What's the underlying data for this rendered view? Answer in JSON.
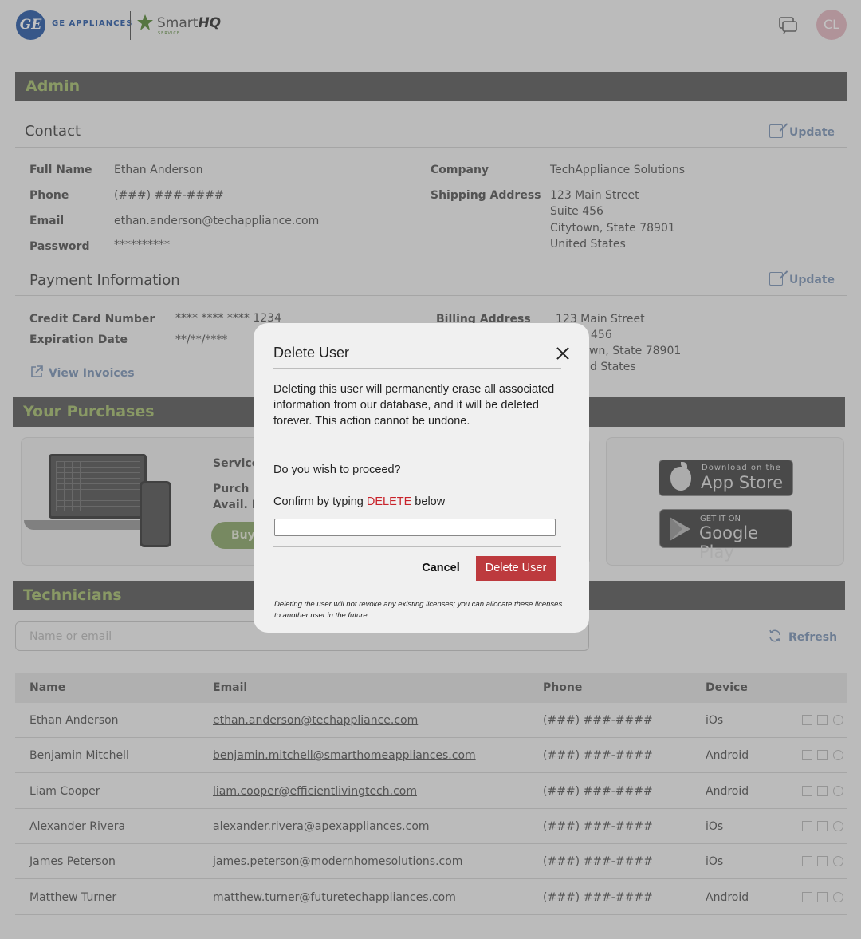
{
  "header": {
    "brand_text": "GE APPLIANCES",
    "brand_logo_text": "GE",
    "smarthq_prefix": "Smart",
    "smarthq_bold": "HQ",
    "smarthq_sub": "SERVICE",
    "avatar_initials": "CL"
  },
  "admin": {
    "bar_title": "Admin",
    "contact_title": "Contact",
    "update_label": "Update",
    "labels": {
      "full_name": "Full Name",
      "phone": "Phone",
      "email": "Email",
      "password": "Password",
      "company": "Company",
      "shipping": "Shipping Address"
    },
    "values": {
      "full_name": "Ethan Anderson",
      "phone": "(###) ###-####",
      "email": "ethan.anderson@techappliance.com",
      "password": "**********",
      "company": "TechAppliance Solutions",
      "shipping_1": "123 Main Street",
      "shipping_2": "Suite 456",
      "shipping_3": "Citytown, State 78901",
      "shipping_4": "United States"
    }
  },
  "payment": {
    "title": "Payment Information",
    "update_label": "Update",
    "cc_label": "Credit Card Number",
    "cc_value": "**** **** **** 1234",
    "exp_label": "Expiration Date",
    "exp_value": "**/**/****",
    "billing_label": "Billing Address",
    "billing_1": "123 Main Street",
    "billing_2": "456",
    "billing_3": "wn, State 78901",
    "billing_4": "d States",
    "view_invoices": "View Invoices"
  },
  "purchases": {
    "bar_title": "Your Purchases",
    "service_label": "Service",
    "purch_label": "Purch L",
    "avail_label": "Avail. Li",
    "buy_label": "Buy",
    "app_store_top": "Download on the",
    "app_store_main": "App Store",
    "google_top": "GET IT ON",
    "google_main": "Google Play"
  },
  "technicians": {
    "bar_title": "Technicians",
    "search_placeholder": "Name or email",
    "refresh_label": "Refresh",
    "columns": {
      "name": "Name",
      "email": "Email",
      "phone": "Phone",
      "device": "Device"
    },
    "rows": [
      {
        "name": "Ethan Anderson",
        "email": "ethan.anderson@techappliance.com",
        "phone": "(###) ###-####",
        "device": "iOs"
      },
      {
        "name": "Benjamin Mitchell",
        "email": "benjamin.mitchell@smarthomeappliances.com",
        "phone": "(###) ###-####",
        "device": "Android"
      },
      {
        "name": "Liam Cooper",
        "email": "liam.cooper@efficientlivingtech.com",
        "phone": "(###) ###-####",
        "device": "Android"
      },
      {
        "name": "Alexander Rivera",
        "email": "alexander.rivera@apexappliances.com",
        "phone": "(###) ###-####",
        "device": "iOs"
      },
      {
        "name": "James Peterson",
        "email": "james.peterson@modernhomesolutions.com",
        "phone": "(###) ###-####",
        "device": "iOs"
      },
      {
        "name": "Matthew Turner",
        "email": "matthew.turner@futuretechappliances.com",
        "phone": "(###) ###-####",
        "device": "Android"
      }
    ]
  },
  "modal": {
    "title": "Delete User",
    "body": "Deleting this user will permanently erase all associated information from our database, and it will be deleted forever. This action cannot be undone.",
    "question": "Do you wish to proceed?",
    "confirm_prefix": "Confirm by typing ",
    "confirm_word": "DELETE",
    "confirm_suffix": " below",
    "input_value": "",
    "cancel_label": "Cancel",
    "delete_label": "Delete User",
    "footnote": "Deleting the user will not revoke any existing licenses; you can allocate these licenses to another user in the future."
  }
}
